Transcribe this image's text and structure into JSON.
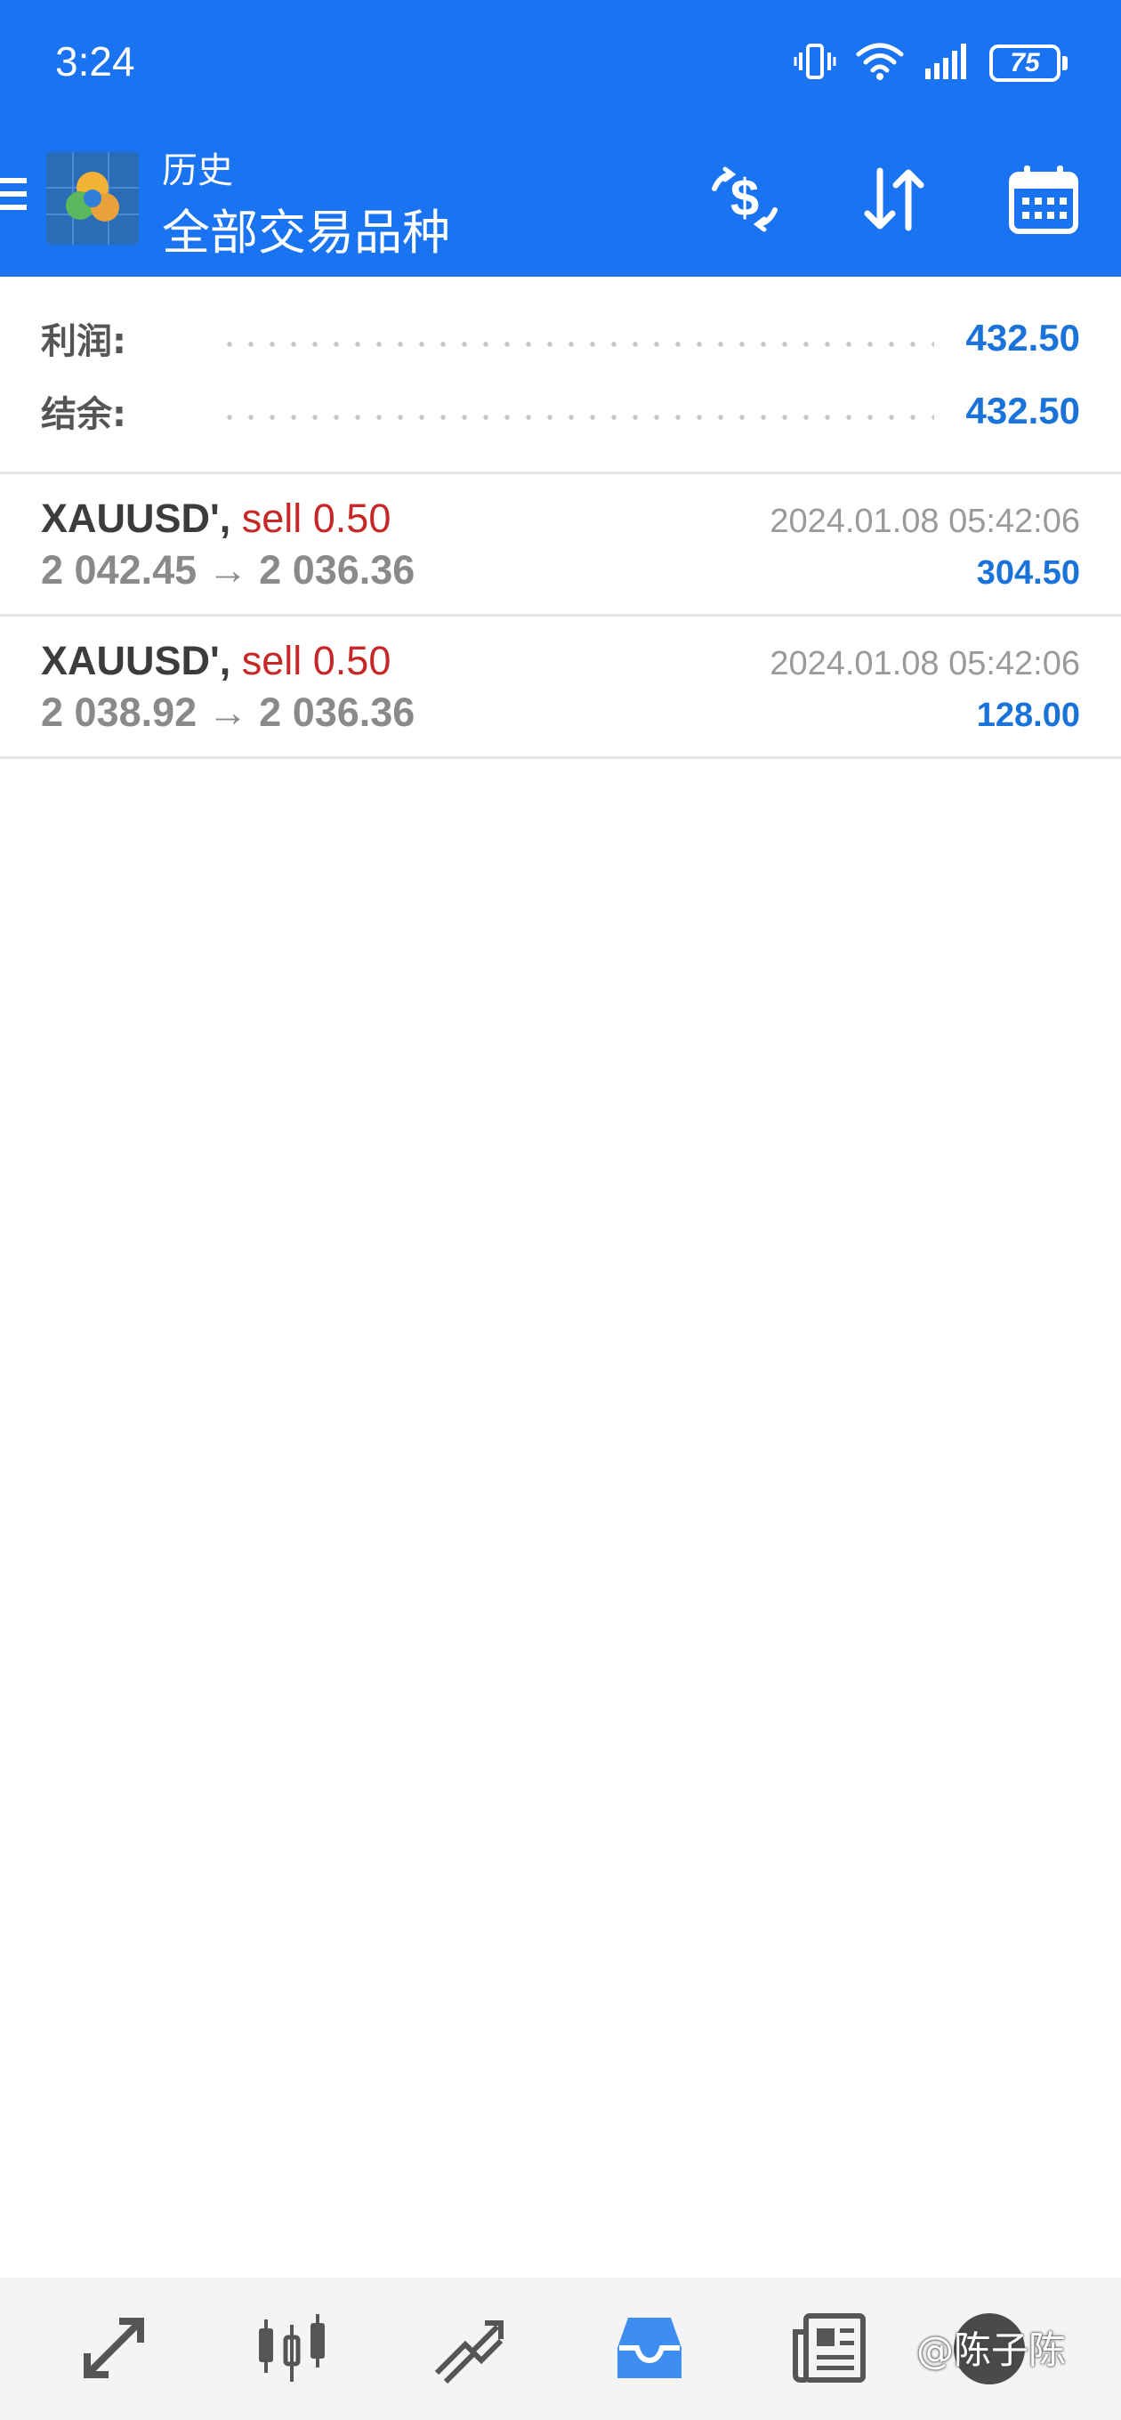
{
  "status_bar": {
    "time": "3:24",
    "battery": "75",
    "icons": [
      "vibrate-icon",
      "wifi-icon",
      "signal-icon",
      "battery-icon"
    ]
  },
  "app_bar": {
    "subtitle": "历史",
    "title": "全部交易品种",
    "actions": [
      "deposit-withdraw-icon",
      "sort-icon",
      "calendar-icon"
    ]
  },
  "summary": {
    "profit_label": "利润:",
    "profit_value": "432.50",
    "balance_label": "结余:",
    "balance_value": "432.50"
  },
  "trades": [
    {
      "symbol": "XAUUSD',",
      "side": "sell 0.50",
      "prices": "2 042.45 → 2 036.36",
      "time": "2024.01.08 05:42:06",
      "profit": "304.50"
    },
    {
      "symbol": "XAUUSD',",
      "side": "sell 0.50",
      "prices": "2 038.92 → 2 036.36",
      "time": "2024.01.08 05:42:06",
      "profit": "128.00"
    }
  ],
  "bottom_nav": {
    "items": [
      "quotes-icon",
      "chart-icon",
      "trade-icon",
      "history-icon",
      "news-icon",
      "messages-icon"
    ],
    "active": "history-icon",
    "watermark": "@陈子陈"
  },
  "colors": {
    "header": "#1a73f0",
    "accent": "#1a73d9",
    "sell": "#c62828",
    "active_tab": "#3d8ef0"
  }
}
